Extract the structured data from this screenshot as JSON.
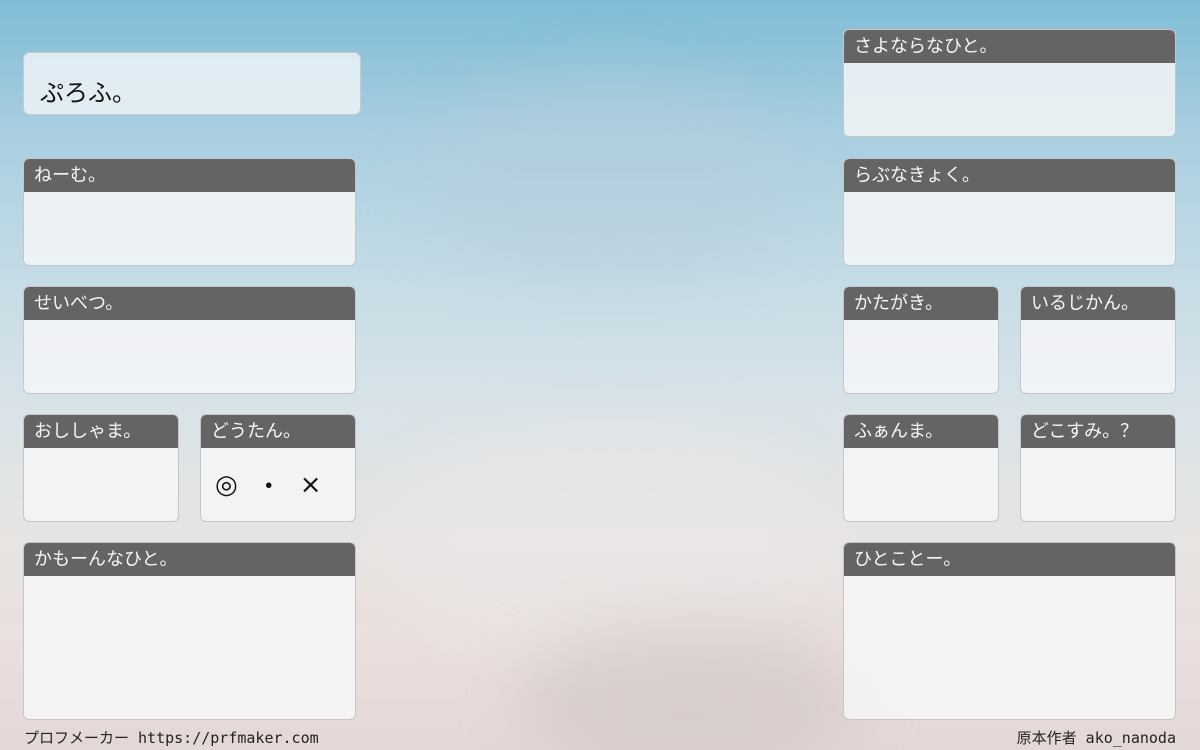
{
  "title": "ぷろふ。",
  "left_panels": {
    "name": {
      "label": "ねーむ。",
      "value": ""
    },
    "gender": {
      "label": "せいべつ。",
      "value": ""
    },
    "fashion": {
      "label": "おししゃま。",
      "value": ""
    },
    "doutan": {
      "label": "どうたん。",
      "marks": [
        "◎",
        "・",
        "×"
      ]
    },
    "kamoon": {
      "label": "かもーんなひと。",
      "value": ""
    }
  },
  "right_panels": {
    "sayonara": {
      "label": "さよならなひと。",
      "value": ""
    },
    "lovenakyoku": {
      "label": "らぶなきょく。",
      "value": ""
    },
    "katagaki": {
      "label": "かたがき。",
      "value": ""
    },
    "irujikan": {
      "label": "いるじかん。",
      "value": ""
    },
    "fanma": {
      "label": "ふぁんま。",
      "value": ""
    },
    "dokosumi": {
      "label": "どこすみ。？",
      "value": ""
    },
    "hitokoto": {
      "label": "ひとことー。",
      "value": ""
    }
  },
  "footer": {
    "left": "プロフメーカー https://prfmaker.com",
    "right": "原本作者 ako_nanoda"
  },
  "colors": {
    "header_bg": "#646464",
    "header_text": "#f6f6f6"
  }
}
